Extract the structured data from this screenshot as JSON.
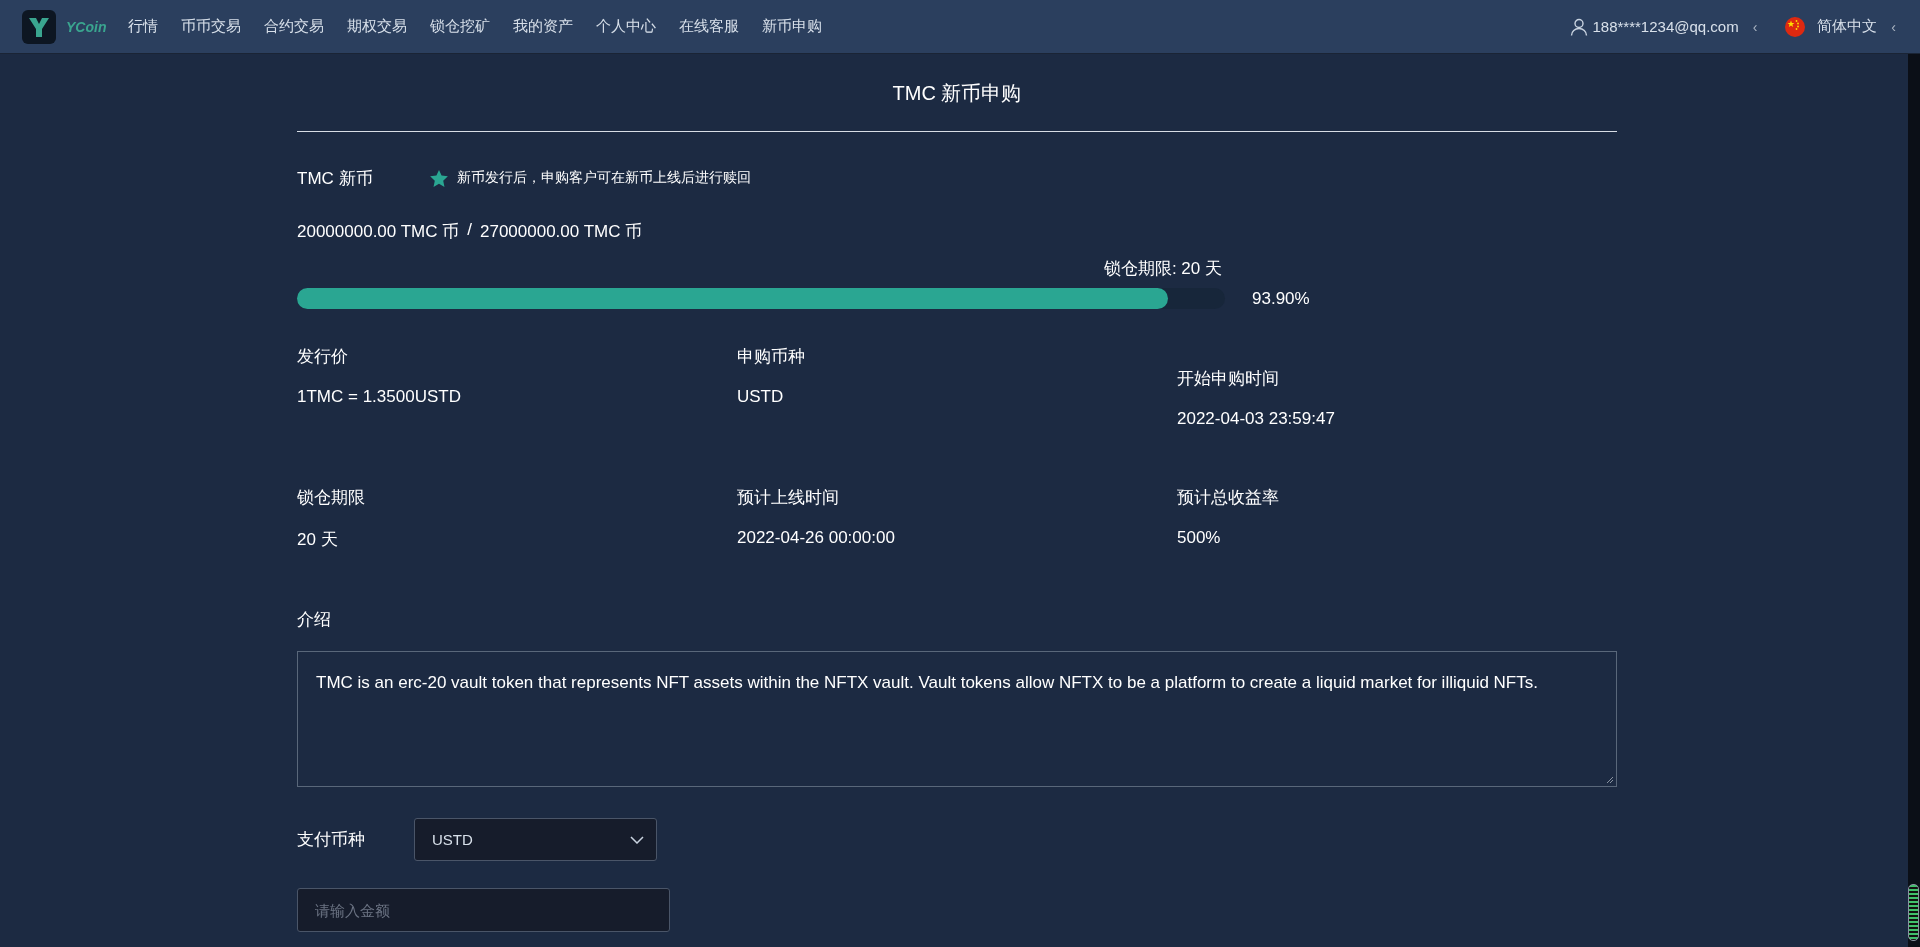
{
  "nav": {
    "brand": "YCoin",
    "items": [
      {
        "label": "行情",
        "selected": false
      },
      {
        "label": "币币交易",
        "selected": false
      },
      {
        "label": "合约交易",
        "selected": false
      },
      {
        "label": "期权交易",
        "selected": false
      },
      {
        "label": "锁仓挖矿",
        "selected": false
      },
      {
        "label": "我的资产",
        "selected": false
      },
      {
        "label": "个人中心",
        "selected": false
      },
      {
        "label": "在线客服",
        "selected": false
      },
      {
        "label": "新币申购",
        "selected": false
      }
    ],
    "account": {
      "label": "188****1234@qq.com",
      "caret": "‹"
    },
    "language": {
      "label": "简体中文",
      "caret": "‹"
    }
  },
  "page_title": "TMC 新币申购",
  "coin": {
    "name": "TMC 新币",
    "note": "新币发行后，申购客户可在新币上线后进行赎回"
  },
  "amounts": {
    "raised": "20000000.00 TMC 币",
    "separator": "/",
    "total": "27000000.00 TMC 币"
  },
  "lock_label": "锁仓期限: 20 天",
  "progress": {
    "level": 0.939,
    "reading": "93.90%"
  },
  "details": [
    {
      "label": "发行价",
      "value": "1TMC = 1.3500USTD"
    },
    {
      "label": "申购币种",
      "value": "USTD"
    },
    {
      "label": "开始申购时间",
      "value": "2022-04-03 23:59:47"
    },
    {
      "label": "锁仓期限",
      "value": "20 天"
    },
    {
      "label": "预计上线时间",
      "value": "2022-04-26 00:00:00"
    },
    {
      "label": "预计总收益率",
      "value": "500%"
    }
  ],
  "intro": {
    "label": "介绍",
    "text": "TMC is an erc-20 vault token that represents NFT assets within the NFTX vault. Vault tokens allow NFTX to be a platform to create a liquid market for illiquid NFTs."
  },
  "payment": {
    "label": "支付币种",
    "value": "USTD"
  },
  "amount_field": {
    "placeholder": "请输入金额"
  }
}
